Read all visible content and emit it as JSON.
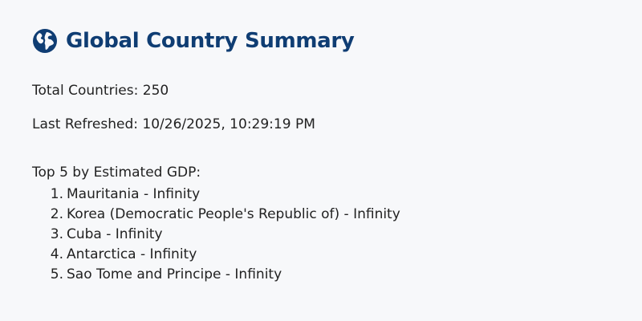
{
  "header": {
    "icon": "globe-icon",
    "title": "Global Country Summary",
    "title_color": "#0f3d73"
  },
  "stats": {
    "total_label": "Total Countries: 250",
    "refreshed_label": "Last Refreshed: 10/26/2025, 10:29:19 PM"
  },
  "top_gdp": {
    "heading": "Top 5 by Estimated GDP:",
    "items": [
      {
        "rank": "1.",
        "text": "Mauritania - Infinity"
      },
      {
        "rank": "2.",
        "text": "Korea (Democratic People's Republic of) - Infinity"
      },
      {
        "rank": "3.",
        "text": "Cuba - Infinity"
      },
      {
        "rank": "4.",
        "text": "Antarctica - Infinity"
      },
      {
        "rank": "5.",
        "text": "Sao Tome and Principe - Infinity"
      }
    ]
  }
}
